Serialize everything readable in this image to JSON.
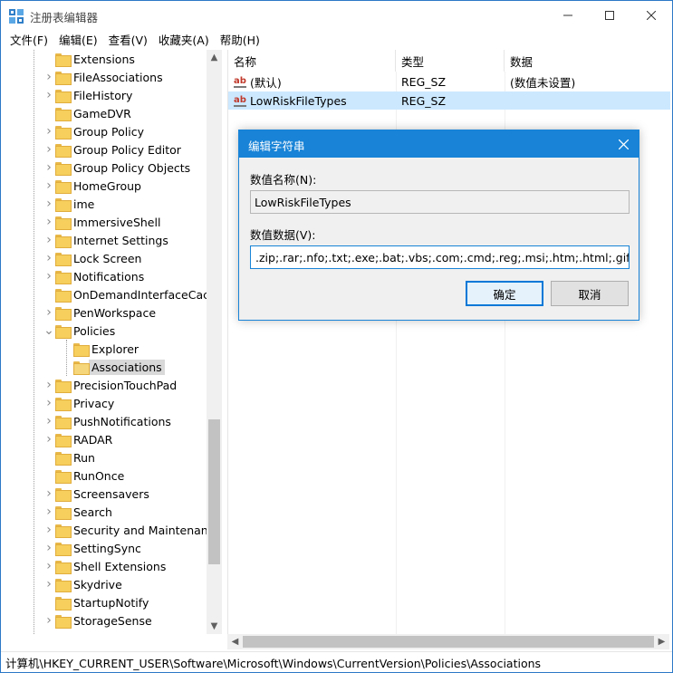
{
  "window": {
    "title": "注册表编辑器"
  },
  "menu": [
    {
      "label": "文件(F)"
    },
    {
      "label": "编辑(E)"
    },
    {
      "label": "查看(V)"
    },
    {
      "label": "收藏夹(A)"
    },
    {
      "label": "帮助(H)"
    }
  ],
  "tree": {
    "items": [
      {
        "label": "Extensions",
        "expandable": false
      },
      {
        "label": "FileAssociations",
        "expandable": true
      },
      {
        "label": "FileHistory",
        "expandable": true
      },
      {
        "label": "GameDVR",
        "expandable": false
      },
      {
        "label": "Group Policy",
        "expandable": true
      },
      {
        "label": "Group Policy Editor",
        "expandable": true
      },
      {
        "label": "Group Policy Objects",
        "expandable": true
      },
      {
        "label": "HomeGroup",
        "expandable": true
      },
      {
        "label": "ime",
        "expandable": true
      },
      {
        "label": "ImmersiveShell",
        "expandable": true
      },
      {
        "label": "Internet Settings",
        "expandable": true
      },
      {
        "label": "Lock Screen",
        "expandable": true
      },
      {
        "label": "Notifications",
        "expandable": true
      },
      {
        "label": "OnDemandInterfaceCach",
        "expandable": false
      },
      {
        "label": "PenWorkspace",
        "expandable": true
      },
      {
        "label": "Policies",
        "expandable": true,
        "expanded": true
      },
      {
        "label": "Explorer",
        "expandable": false,
        "child": true
      },
      {
        "label": "Associations",
        "expandable": false,
        "child": true,
        "selected": true
      },
      {
        "label": "PrecisionTouchPad",
        "expandable": true
      },
      {
        "label": "Privacy",
        "expandable": true
      },
      {
        "label": "PushNotifications",
        "expandable": true
      },
      {
        "label": "RADAR",
        "expandable": true
      },
      {
        "label": "Run",
        "expandable": false
      },
      {
        "label": "RunOnce",
        "expandable": false
      },
      {
        "label": "Screensavers",
        "expandable": true
      },
      {
        "label": "Search",
        "expandable": true
      },
      {
        "label": "Security and Maintenanc",
        "expandable": true
      },
      {
        "label": "SettingSync",
        "expandable": true
      },
      {
        "label": "Shell Extensions",
        "expandable": true
      },
      {
        "label": "Skydrive",
        "expandable": true
      },
      {
        "label": "StartupNotify",
        "expandable": false
      },
      {
        "label": "StorageSense",
        "expandable": true
      }
    ]
  },
  "list": {
    "columns": {
      "name": "名称",
      "type": "类型",
      "data": "数据"
    },
    "rows": [
      {
        "name": "(默认)",
        "type": "REG_SZ",
        "data": "(数值未设置)",
        "selected": false
      },
      {
        "name": "LowRiskFileTypes",
        "type": "REG_SZ",
        "data": "",
        "selected": true
      }
    ]
  },
  "status": {
    "path": "计算机\\HKEY_CURRENT_USER\\Software\\Microsoft\\Windows\\CurrentVersion\\Policies\\Associations"
  },
  "dialog": {
    "title": "编辑字符串",
    "name_label": "数值名称(N):",
    "name_value": "LowRiskFileTypes",
    "data_label": "数值数据(V):",
    "data_value": ".zip;.rar;.nfo;.txt;.exe;.bat;.vbs;.com;.cmd;.reg;.msi;.htm;.html;.gif;.bmp;.jpg",
    "ok_label": "确定",
    "cancel_label": "取消"
  },
  "colors": {
    "accent": "#1883d7",
    "selection": "#cce8ff",
    "folder": "#f6cf5d"
  }
}
